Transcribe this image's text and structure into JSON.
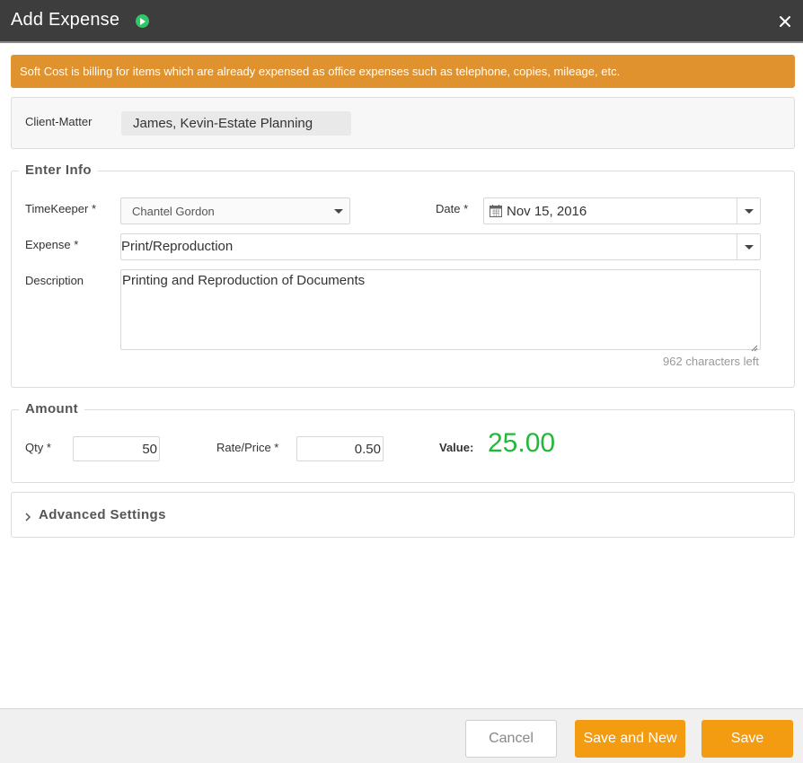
{
  "window": {
    "title": "Add Expense",
    "play_icon": "play-circle-icon",
    "close_icon": "close-icon"
  },
  "banner": {
    "text": "Soft Cost is billing for items which are already expensed as office expenses such as telephone, copies, mileage, etc."
  },
  "client_matter": {
    "label": "Client-Matter",
    "value": "James, Kevin-Estate Planning"
  },
  "enter_info": {
    "legend": "Enter Info",
    "timekeeper_label": "TimeKeeper *",
    "timekeeper_value": "Chantel Gordon",
    "date_label": "Date *",
    "date_value": "Nov 15, 2016",
    "expense_label": "Expense *",
    "expense_value": "Print/Reproduction",
    "description_label": "Description",
    "description_value": "Printing and Reproduction of Documents",
    "chars_left": "962 characters left"
  },
  "amount": {
    "legend": "Amount",
    "qty_label": "Qty *",
    "qty_value": "50",
    "rate_label": "Rate/Price *",
    "rate_value": "0.50",
    "value_label": "Value:",
    "value": "25.00"
  },
  "advanced": {
    "label": "Advanced Settings"
  },
  "footer": {
    "cancel": "Cancel",
    "save_new": "Save and New",
    "save": "Save"
  },
  "colors": {
    "titlebar": "#3d3d3d",
    "banner": "#e0922f",
    "accent_button": "#f39c12",
    "value_green": "#22b83a",
    "play_green": "#2ec866"
  }
}
